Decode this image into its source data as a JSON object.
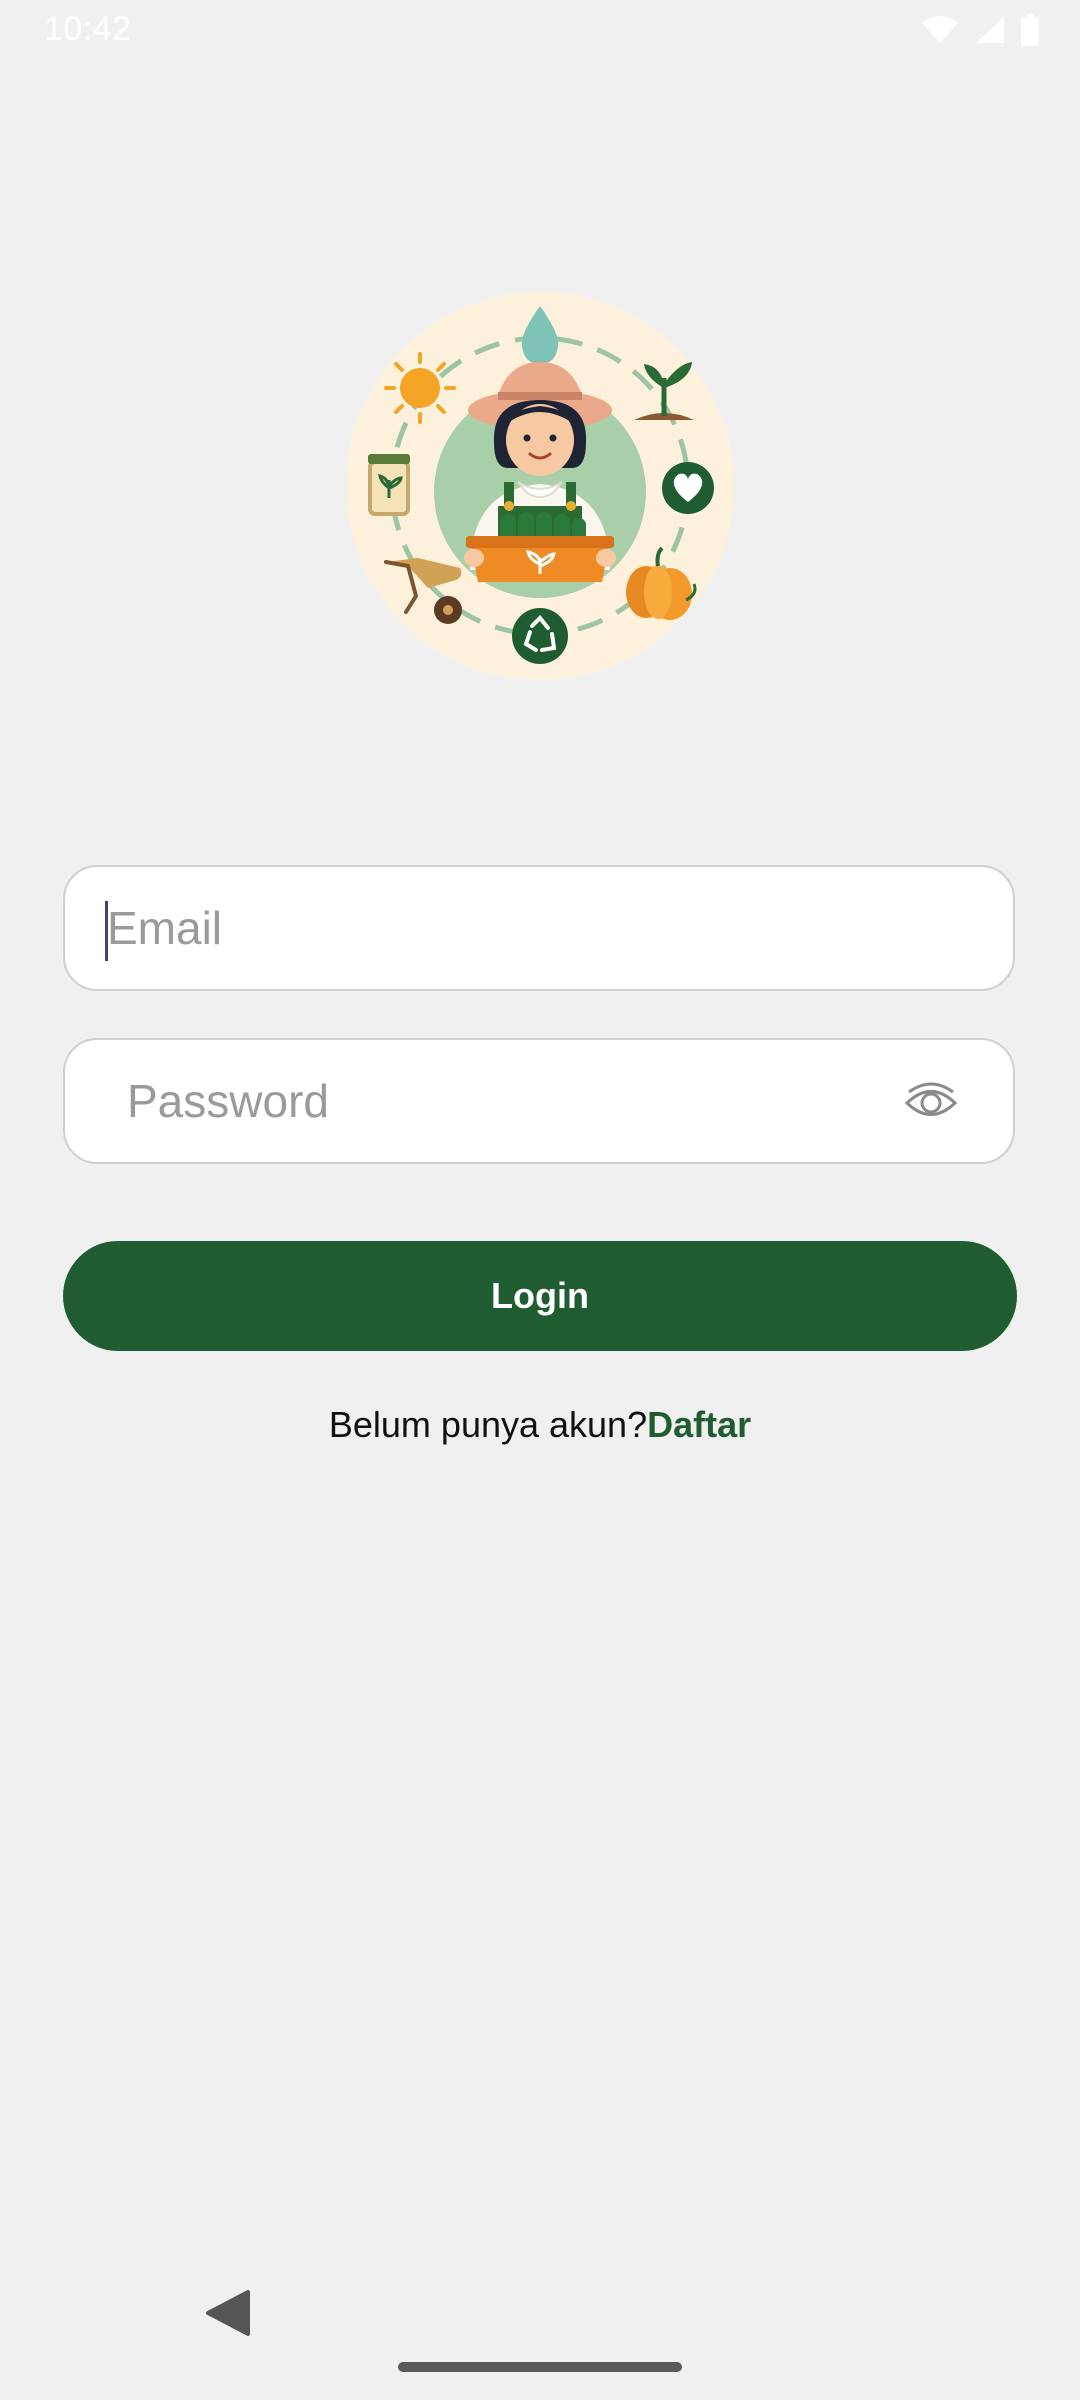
{
  "status_bar": {
    "time": "10:42",
    "icons": [
      "wifi-icon",
      "cell-signal-icon",
      "battery-icon"
    ]
  },
  "logo": {
    "icon": "farmer-illustration"
  },
  "form": {
    "email_placeholder": "Email",
    "password_placeholder": "Password",
    "toggle_icon": "eye-icon",
    "login_label": "Login"
  },
  "register": {
    "prompt": "Belum punya akun?",
    "link": "Daftar"
  },
  "nav": {
    "back_icon": "back-triangle-icon",
    "home_icon": "home-pill"
  },
  "colors": {
    "primary": "#1f5c30",
    "background": "#f0f0f0",
    "placeholder": "#9a9a9a"
  }
}
